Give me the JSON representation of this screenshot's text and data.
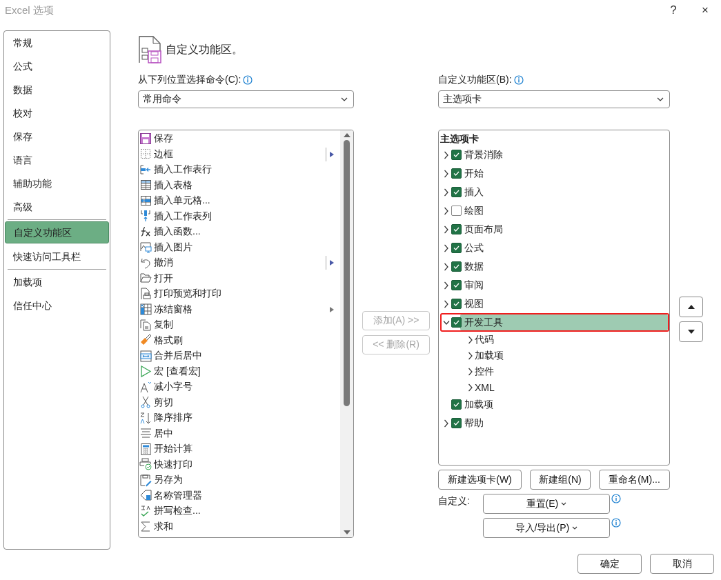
{
  "window": {
    "title": "Excel 选项",
    "help_button": "?",
    "close_button": "×"
  },
  "sidebar": {
    "groups": [
      {
        "items": [
          {
            "label": "常规",
            "selected": false
          },
          {
            "label": "公式",
            "selected": false
          },
          {
            "label": "数据",
            "selected": false
          },
          {
            "label": "校对",
            "selected": false
          },
          {
            "label": "保存",
            "selected": false
          },
          {
            "label": "语言",
            "selected": false
          },
          {
            "label": "辅助功能",
            "selected": false
          },
          {
            "label": "高级",
            "selected": false
          }
        ]
      },
      {
        "items": [
          {
            "label": "自定义功能区",
            "selected": true
          },
          {
            "label": "快速访问工具栏",
            "selected": false
          }
        ]
      },
      {
        "items": [
          {
            "label": "加载项",
            "selected": false
          },
          {
            "label": "信任中心",
            "selected": false
          }
        ]
      }
    ]
  },
  "heading": "自定义功能区。",
  "commands": {
    "label": "从下列位置选择命令(C):",
    "dropdown": "常用命令",
    "items": [
      {
        "label": "保存",
        "kind": "plain"
      },
      {
        "label": "边框",
        "kind": "split"
      },
      {
        "label": "插入工作表行",
        "kind": "plain"
      },
      {
        "label": "插入表格",
        "kind": "plain"
      },
      {
        "label": "插入单元格...",
        "kind": "plain"
      },
      {
        "label": "插入工作表列",
        "kind": "plain"
      },
      {
        "label": "插入函数...",
        "kind": "plain"
      },
      {
        "label": "插入图片",
        "kind": "plain"
      },
      {
        "label": "撤消",
        "kind": "split"
      },
      {
        "label": "打开",
        "kind": "plain"
      },
      {
        "label": "打印预览和打印",
        "kind": "plain"
      },
      {
        "label": "冻结窗格",
        "kind": "submenu"
      },
      {
        "label": "复制",
        "kind": "plain"
      },
      {
        "label": "格式刷",
        "kind": "plain"
      },
      {
        "label": "合并后居中",
        "kind": "plain"
      },
      {
        "label": "宏 [查看宏]",
        "kind": "plain"
      },
      {
        "label": "减小字号",
        "kind": "plain"
      },
      {
        "label": "剪切",
        "kind": "plain"
      },
      {
        "label": "降序排序",
        "kind": "plain"
      },
      {
        "label": "居中",
        "kind": "plain"
      },
      {
        "label": "开始计算",
        "kind": "plain"
      },
      {
        "label": "快速打印",
        "kind": "plain"
      },
      {
        "label": "另存为",
        "kind": "plain"
      },
      {
        "label": "名称管理器",
        "kind": "plain"
      },
      {
        "label": "拼写检查...",
        "kind": "plain"
      },
      {
        "label": "求和",
        "kind": "plain"
      }
    ]
  },
  "transfer_buttons": [
    {
      "label": "添加(A) >>",
      "disabled": true
    },
    {
      "label": "<< 删除(R)",
      "disabled": true
    }
  ],
  "ribbon": {
    "label": "自定义功能区(B):",
    "dropdown": "主选项卡",
    "tree_header": "主选项卡",
    "tabs": [
      {
        "label": "背景消除",
        "kind": "tab",
        "checked": true,
        "expanded": false,
        "selected": false,
        "annotated": false
      },
      {
        "label": "开始",
        "kind": "tab",
        "checked": true,
        "expanded": false,
        "selected": false,
        "annotated": false
      },
      {
        "label": "插入",
        "kind": "tab",
        "checked": true,
        "expanded": false,
        "selected": false,
        "annotated": false
      },
      {
        "label": "绘图",
        "kind": "tab",
        "checked": false,
        "expanded": false,
        "selected": false,
        "annotated": false
      },
      {
        "label": "页面布局",
        "kind": "tab",
        "checked": true,
        "expanded": false,
        "selected": false,
        "annotated": false
      },
      {
        "label": "公式",
        "kind": "tab",
        "checked": true,
        "expanded": false,
        "selected": false,
        "annotated": false
      },
      {
        "label": "数据",
        "kind": "tab",
        "checked": true,
        "expanded": false,
        "selected": false,
        "annotated": false
      },
      {
        "label": "审阅",
        "kind": "tab",
        "checked": true,
        "expanded": false,
        "selected": false,
        "annotated": false
      },
      {
        "label": "视图",
        "kind": "tab",
        "checked": true,
        "expanded": false,
        "selected": false,
        "annotated": false
      },
      {
        "label": "开发工具",
        "kind": "tab",
        "checked": true,
        "expanded": true,
        "selected": true,
        "annotated": true,
        "children": [
          {
            "label": "代码",
            "expanded": false
          },
          {
            "label": "加载项",
            "expanded": false
          },
          {
            "label": "控件",
            "expanded": false
          },
          {
            "label": "XML",
            "expanded": false
          }
        ]
      },
      {
        "label": "加载项",
        "kind": "leaf",
        "checked": true,
        "selected": false,
        "annotated": false
      },
      {
        "label": "帮助",
        "kind": "tab",
        "checked": true,
        "expanded": false,
        "selected": false,
        "annotated": false
      }
    ],
    "buttons": [
      "新建选项卡(W)",
      "新建组(N)",
      "重命名(M)..."
    ],
    "customize_label": "自定义:",
    "reset_button": "重置(E)",
    "import_export_button": "导入/导出(P)"
  },
  "footer_buttons": [
    "确定",
    "取消"
  ]
}
